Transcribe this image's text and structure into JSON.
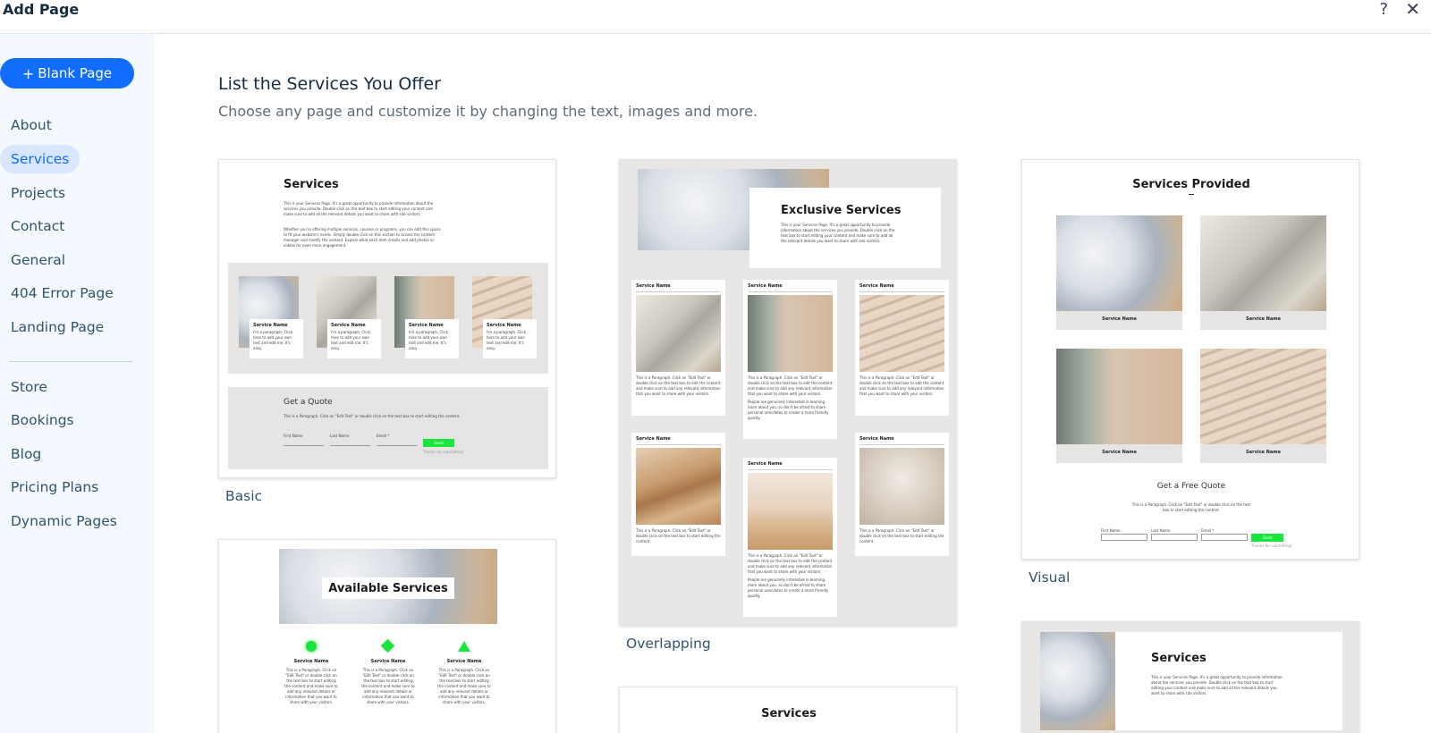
{
  "header": {
    "title": "Add Page",
    "help_glyph": "?",
    "close_glyph": "✕"
  },
  "sidebar": {
    "blank_page_label": "Blank Page",
    "items": [
      {
        "label": "About"
      },
      {
        "label": "Services",
        "active": true
      },
      {
        "label": "Projects"
      },
      {
        "label": "Contact"
      },
      {
        "label": "General"
      },
      {
        "label": "404 Error Page"
      },
      {
        "label": "Landing Page"
      },
      {
        "label": "Store"
      },
      {
        "label": "Bookings"
      },
      {
        "label": "Blog"
      },
      {
        "label": "Pricing Plans"
      },
      {
        "label": "Dynamic Pages"
      }
    ]
  },
  "main": {
    "heading": "List the Services You Offer",
    "subheading": "Choose any page and customize it by changing the text, images and more."
  },
  "templates": [
    {
      "label": "Basic",
      "title": "Services",
      "intro": "This is your Services Page. It's a great opportunity to provide information about the services you provide. Double click on the text box to start editing your content and make sure to add all the relevant details you want to share with site visitors.",
      "intro2": "Whether you're offering multiple services, courses or programs, you can edit this space to fit your website's needs. Simply double click on this section to access the content manager and modify the content. Explain what each item entails and add photos or videos for even more engagement.",
      "service_name": "Service Name",
      "service_text": "I'm a paragraph. Click here to add your own text and edit me. It's easy.",
      "quote_title": "Get a Quote",
      "quote_text": "This is a Paragraph. Click on \"Edit Text\" or double click on the text box to start editing the content.",
      "field_first": "First Name",
      "field_last": "Last Name",
      "field_email": "Email *",
      "send": "Send",
      "thanks": "Thanks for submitting!"
    },
    {
      "label": "Overlapping",
      "title": "Exclusive Services",
      "intro": "This is your Services Page. It's a great opportunity to provide information about the services you provide. Double click on the text box to start editing your content and make sure to add all the relevant details you want to share with site visitors.",
      "service_name": "Service Name",
      "service_text": "This is a Paragraph. Click on \"Edit Text\" or double click on the text box to edit the content and make sure to add any relevant information that you want to share with your visitors.",
      "service_text2": "People are genuinely interested in learning more about you, so don't be afraid to share personal anecdotes to create a more friendly quality.",
      "service_text_short": "This is a Paragraph. Click on \"Edit Text\" or double click on the text box to start editing the content."
    },
    {
      "label": "Visual",
      "title": "Services Provided",
      "service_name": "Service Name",
      "quote_title": "Get a Free Quote",
      "quote_text": "This is a Paragraph. Click on \"Edit Text\" or double click on the text box to start editing the content.",
      "field_first": "First Name",
      "field_last": "Last Name",
      "field_email": "Email *",
      "send": "Send",
      "thanks": "Thanks for submitting!"
    },
    {
      "title": "Available Services",
      "service_name": "Service Name",
      "service_text": "This is a Paragraph. Click on \"Edit Text\" or double click on the text box to start editing the content and make sure to add any relevant details or information that you want to share with your visitors."
    },
    {
      "title": "Services"
    },
    {
      "title": "Services",
      "intro": "This is your Services Page. It's a great opportunity to provide information about the services you provide. Double click on the text box to start editing your content and make sure to add all the relevant details you want to share with site visitors."
    }
  ]
}
